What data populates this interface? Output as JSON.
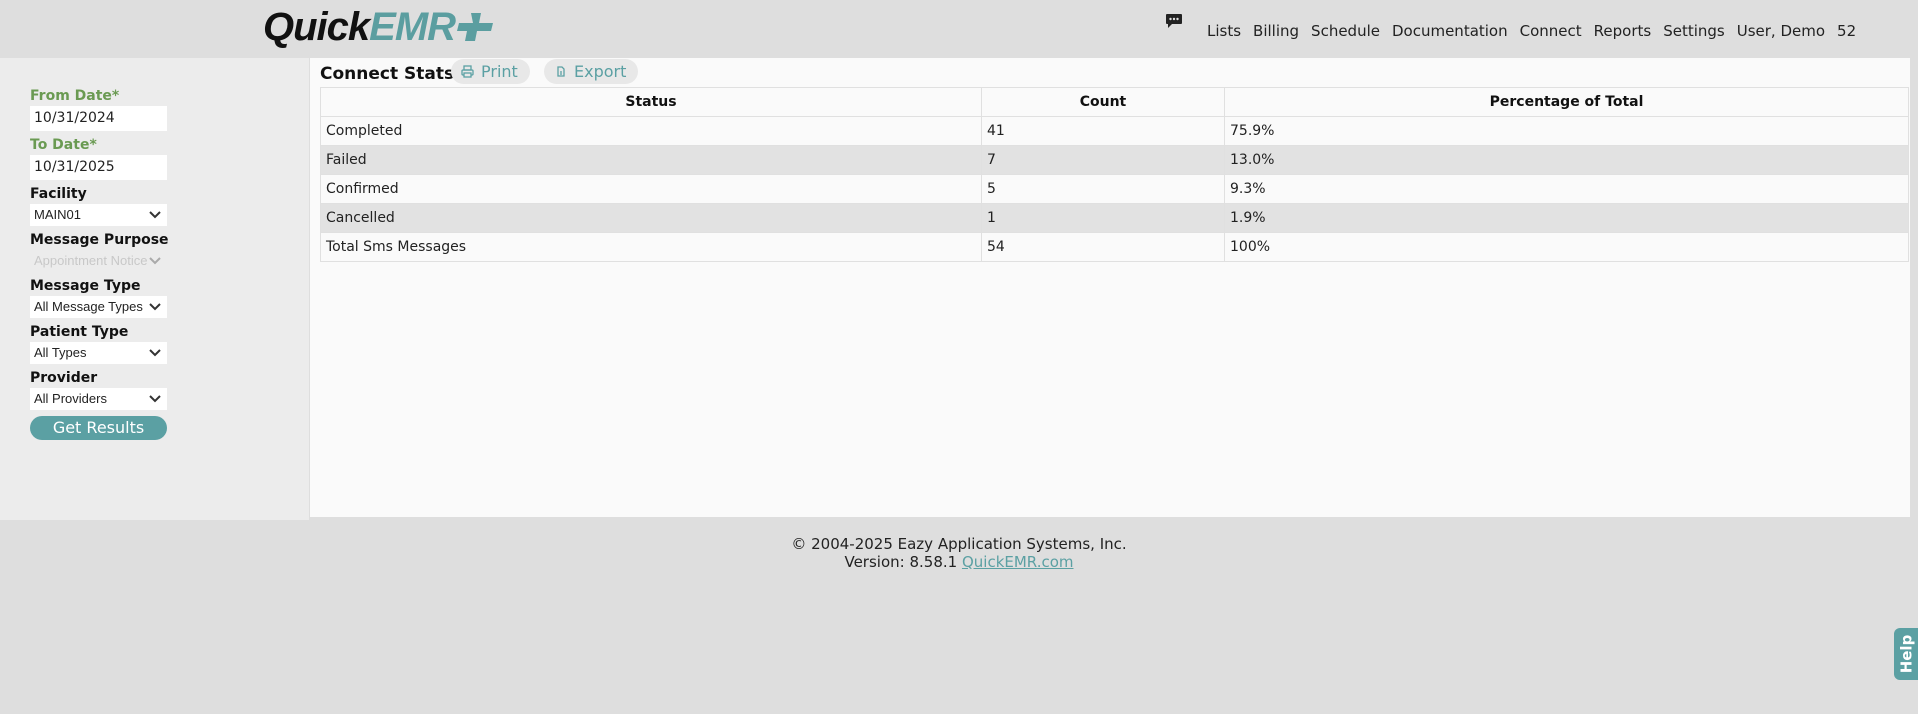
{
  "header": {
    "logo_quick": "Quick",
    "logo_emr": "EMR",
    "nav": [
      "Lists",
      "Billing",
      "Schedule",
      "Documentation",
      "Connect",
      "Reports",
      "Settings",
      "User, Demo",
      "52"
    ],
    "chat_icon": "chat-bubble-icon"
  },
  "sidebar": {
    "from_date_label": "From Date*",
    "from_date_value": "10/31/2024",
    "to_date_label": "To Date*",
    "to_date_value": "10/31/2025",
    "facility_label": "Facility",
    "facility_value": "MAIN01",
    "message_purpose_label": "Message Purpose",
    "message_purpose_value": "Appointment Notice",
    "message_type_label": "Message Type",
    "message_type_value": "All Message Types",
    "patient_type_label": "Patient Type",
    "patient_type_value": "All Types",
    "provider_label": "Provider",
    "provider_value": "All Providers",
    "get_results_label": "Get Results"
  },
  "main": {
    "title": "Connect Stats",
    "print_label": "Print",
    "export_label": "Export",
    "table": {
      "headers": [
        "Status",
        "Count",
        "Percentage of Total"
      ],
      "rows": [
        [
          "Completed",
          "41",
          "75.9%"
        ],
        [
          "Failed",
          "7",
          "13.0%"
        ],
        [
          "Confirmed",
          "5",
          "9.3%"
        ],
        [
          "Cancelled",
          "1",
          "1.9%"
        ],
        [
          "Total Sms Messages",
          "54",
          "100%"
        ]
      ]
    }
  },
  "footer": {
    "copyright": "© 2004-2025 Eazy Application Systems, Inc.",
    "version_prefix": "Version: 8.58.1",
    "link_text": "QuickEMR.com"
  },
  "help": {
    "label": "Help"
  },
  "colors": {
    "accent": "#5ba0a3",
    "label_green": "#6a9a52",
    "background": "#dedede"
  }
}
